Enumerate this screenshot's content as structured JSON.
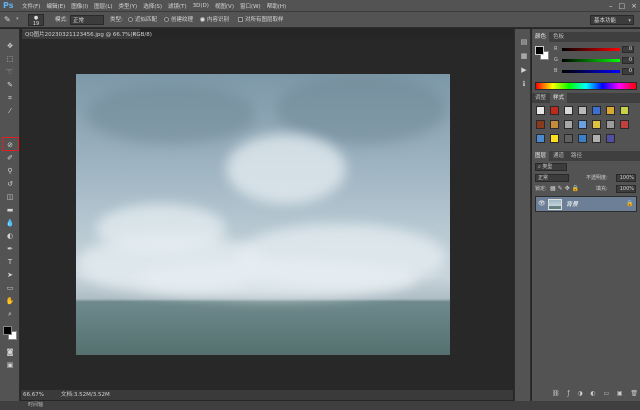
{
  "app": {
    "logo": "Ps"
  },
  "menu": [
    "文件(F)",
    "编辑(E)",
    "图像(I)",
    "图层(L)",
    "类型(Y)",
    "选择(S)",
    "滤镜(T)",
    "3D(D)",
    "视图(V)",
    "窗口(W)",
    "帮助(H)"
  ],
  "window_controls": {
    "minimize": "–",
    "maximize": "□",
    "close": "×"
  },
  "options": {
    "brush_size": "19",
    "mode_label": "模式:",
    "mode_value": "正常",
    "type_label": "类型:",
    "type_near_match": "近似匹配",
    "type_create_texture": "创建纹理",
    "type_content_aware": "内容识别",
    "sample_all_layers": "对所有图层取样",
    "workspace_preset": "基本功能"
  },
  "document": {
    "tab_label": "QQ图片20230321123456.jpg @ 66.7%(RGB/8)",
    "close_glyph": "×"
  },
  "status": {
    "zoom": "66.67%",
    "doc_size": "文档:3.52M/3.52M",
    "timeline": "时间轴"
  },
  "color_panel": {
    "tabs": [
      "颜色",
      "色板"
    ],
    "channels": [
      {
        "label": "R",
        "value": "0",
        "gradient": "linear-gradient(to right,#000,#f00)"
      },
      {
        "label": "G",
        "value": "0",
        "gradient": "linear-gradient(to right,#000,#0f0)"
      },
      {
        "label": "B",
        "value": "0",
        "gradient": "linear-gradient(to right,#000,#00f)"
      }
    ]
  },
  "styles_panel": {
    "tabs": [
      "调整",
      "样式"
    ],
    "swatch_colors": [
      "#e8e8e8",
      "#c02a1a",
      "#d8d8d8",
      "#b9b9b9",
      "#3b6fd0",
      "#d9a830",
      "#c7d24a",
      "#8a3a1c",
      "#c68a3a",
      "#a8a8a8",
      "#6aa0e0",
      "#e0c040",
      "#9c9c9c",
      "#c04040",
      "#4a8ad0",
      "#ffe020",
      "#606060",
      "#3a80c8",
      "#b0b0b0",
      "#5050a0"
    ]
  },
  "layers_panel": {
    "tabs": [
      "图层",
      "通道",
      "路径"
    ],
    "filter_label": "类型",
    "blend_mode": "正常",
    "opacity_label": "不透明度:",
    "opacity_value": "100%",
    "lock_label": "锁定:",
    "fill_label": "填充:",
    "fill_value": "100%",
    "layers": [
      {
        "name": "背景",
        "visible": true,
        "locked": true
      }
    ]
  },
  "tools": [
    "move-icon",
    "marquee-icon",
    "lasso-icon",
    "quick-select-icon",
    "crop-icon",
    "eyedropper-icon",
    "healing-brush-icon",
    "brush-icon",
    "clone-stamp-icon",
    "history-brush-icon",
    "eraser-icon",
    "gradient-icon",
    "blur-icon",
    "dodge-icon",
    "pen-icon",
    "type-icon",
    "path-select-icon",
    "shape-icon",
    "hand-icon",
    "zoom-icon"
  ],
  "colors": {
    "foreground": "#000000",
    "background": "#ffffff",
    "highlight": "#e02020"
  }
}
